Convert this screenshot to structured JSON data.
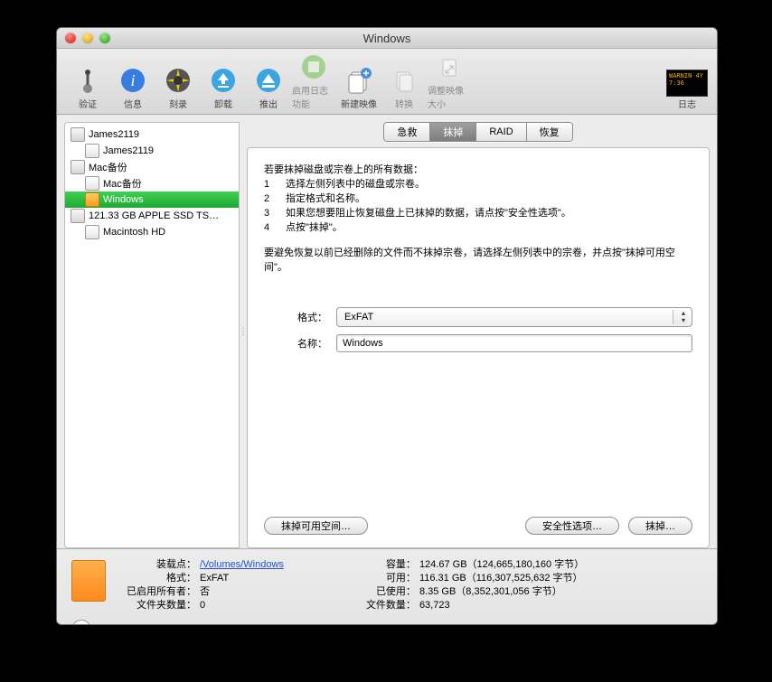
{
  "window": {
    "title": "Windows"
  },
  "toolbar": {
    "items": [
      {
        "name": "verify",
        "label": "验证"
      },
      {
        "name": "info",
        "label": "信息"
      },
      {
        "name": "burn",
        "label": "刻录"
      },
      {
        "name": "unmount",
        "label": "卸载"
      },
      {
        "name": "eject",
        "label": "推出"
      },
      {
        "name": "journaling",
        "label": "启用日志功能",
        "disabled": true
      },
      {
        "name": "newimage",
        "label": "新建映像"
      },
      {
        "name": "convert",
        "label": "转换",
        "disabled": true
      },
      {
        "name": "resize",
        "label": "调整映像大小",
        "disabled": true
      }
    ],
    "log_label": "日志",
    "log_text": "WARNIN\n4Y 7:36"
  },
  "sidebar": {
    "items": [
      {
        "label": "James2119",
        "kind": "disk"
      },
      {
        "label": "James2119",
        "kind": "vol",
        "child": true
      },
      {
        "label": "Mac备份",
        "kind": "disk"
      },
      {
        "label": "Mac备份",
        "kind": "vol",
        "child": true
      },
      {
        "label": "Windows",
        "kind": "ext",
        "child": true,
        "selected": true
      },
      {
        "label": "121.33 GB APPLE SSD TS…",
        "kind": "disk"
      },
      {
        "label": "Macintosh HD",
        "kind": "vol",
        "child": true
      }
    ]
  },
  "tabs": {
    "items": [
      {
        "label": "急救"
      },
      {
        "label": "抹掉",
        "active": true
      },
      {
        "label": "RAID"
      },
      {
        "label": "恢复"
      }
    ]
  },
  "panel": {
    "intro": "若要抹掉磁盘或宗卷上的所有数据：",
    "steps": [
      "选择左侧列表中的磁盘或宗卷。",
      "指定格式和名称。",
      "如果您想要阻止恢复磁盘上已抹掉的数据，请点按\"安全性选项\"。",
      "点按\"抹掉\"。"
    ],
    "note": "要避免恢复以前已经删除的文件而不抹掉宗卷，请选择左侧列表中的宗卷，并点按\"抹掉可用空间\"。",
    "format_label": "格式：",
    "format_value": "ExFAT",
    "name_label": "名称：",
    "name_value": "Windows",
    "buttons": {
      "erase_free": "抹掉可用空间…",
      "security": "安全性选项…",
      "erase": "抹掉…"
    }
  },
  "footer": {
    "left": [
      {
        "k": "装载点：",
        "v": "/Volumes/Windows",
        "link": true
      },
      {
        "k": "格式：",
        "v": "ExFAT"
      },
      {
        "k": "已启用所有者：",
        "v": "否"
      },
      {
        "k": "文件夹数量：",
        "v": "0"
      }
    ],
    "right": [
      {
        "k": "容量：",
        "v": "124.67 GB（124,665,180,160 字节）"
      },
      {
        "k": "可用：",
        "v": "116.31 GB（116,307,525,632 字节）"
      },
      {
        "k": "已使用：",
        "v": "8.35 GB（8,352,301,056 字节）"
      },
      {
        "k": "文件数量：",
        "v": "63,723"
      }
    ]
  }
}
